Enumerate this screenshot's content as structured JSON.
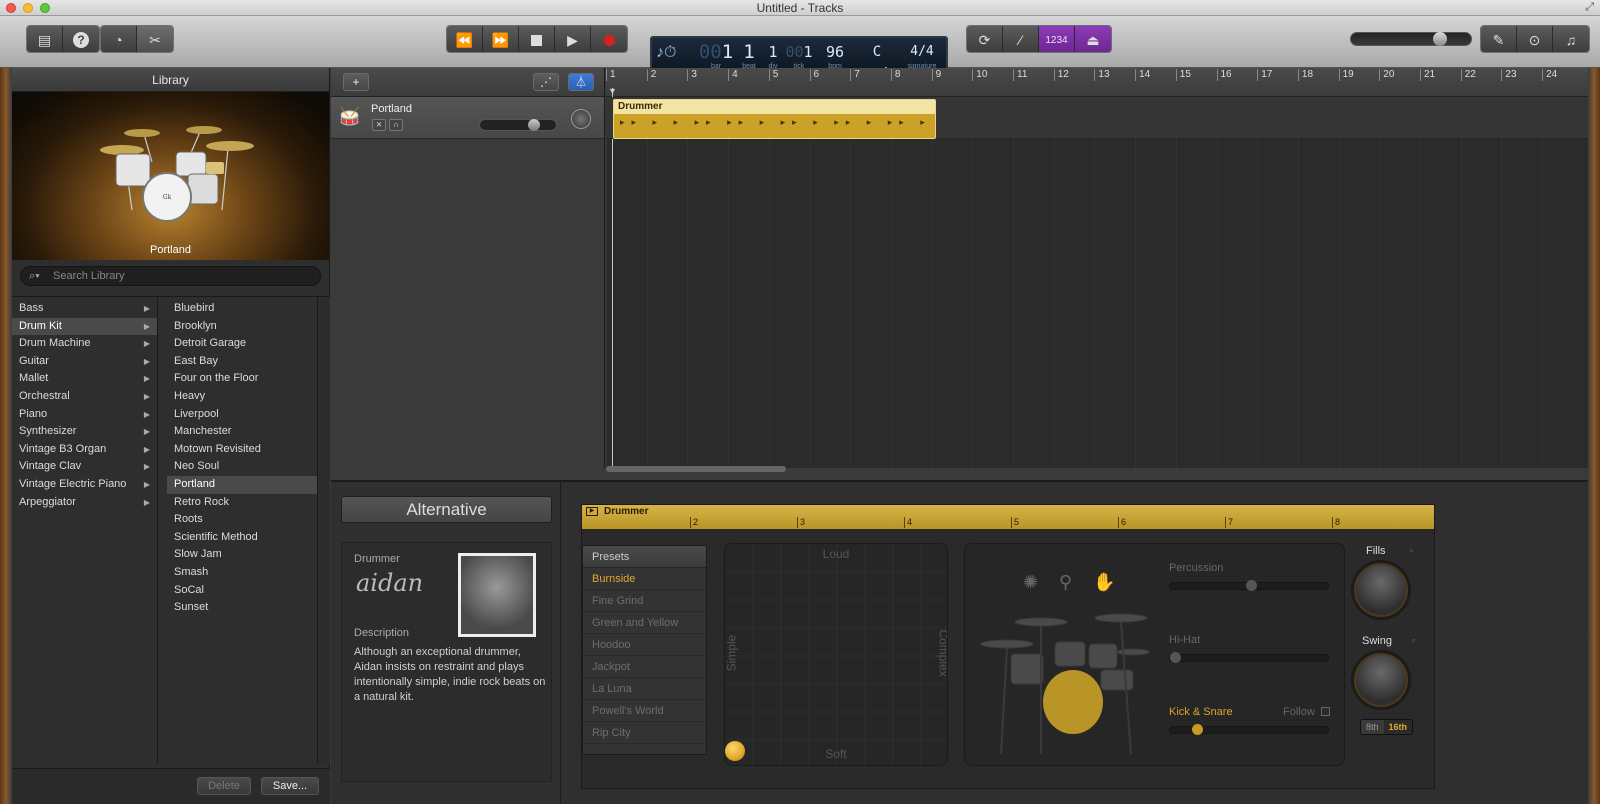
{
  "window": {
    "title": "Untitled - Tracks"
  },
  "toolbar": {
    "lcd": {
      "bar": "1",
      "beat": "1",
      "div": "1",
      "tick": "1",
      "bpm": "96",
      "key": "C maj",
      "signature": "4/4",
      "labels": {
        "bar": "bar",
        "beat": "beat",
        "div": "div",
        "tick": "tick",
        "bpm": "bpm",
        "key": "key",
        "signature": "signature"
      }
    },
    "countin": "1234"
  },
  "library": {
    "header": "Library",
    "patch_caption": "Portland",
    "search_placeholder": "Search Library",
    "categories": [
      "Bass",
      "Drum Kit",
      "Drum Machine",
      "Guitar",
      "Mallet",
      "Orchestral",
      "Piano",
      "Synthesizer",
      "Vintage B3 Organ",
      "Vintage Clav",
      "Vintage Electric Piano",
      "Arpeggiator"
    ],
    "selected_category": "Drum Kit",
    "patches": [
      "Bluebird",
      "Brooklyn",
      "Detroit Garage",
      "East Bay",
      "Four on the Floor",
      "Heavy",
      "Liverpool",
      "Manchester",
      "Motown Revisited",
      "Neo Soul",
      "Portland",
      "Retro Rock",
      "Roots",
      "Scientific Method",
      "Slow Jam",
      "Smash",
      "SoCal",
      "Sunset"
    ],
    "selected_patch": "Portland",
    "delete_label": "Delete",
    "save_label": "Save..."
  },
  "tracks": {
    "track_name": "Portland",
    "region_name": "Drummer",
    "ruler_bars": [
      "1",
      "2",
      "3",
      "4",
      "5",
      "6",
      "7",
      "8",
      "9",
      "10",
      "11",
      "12",
      "13",
      "14",
      "15",
      "16",
      "17",
      "18",
      "19",
      "20",
      "21",
      "22",
      "23",
      "24"
    ]
  },
  "drummer_editor": {
    "alt_button": "Alternative",
    "drummer_label": "Drummer",
    "drummer_signature": "aidan",
    "description_label": "Description",
    "description": "Although an exceptional drummer, Aidan insists on restraint and plays intentionally simple, indie rock beats on a natural kit.",
    "header_title": "Drummer",
    "ruler": [
      "2",
      "3",
      "4",
      "5",
      "6",
      "7",
      "8"
    ],
    "presets_header": "Presets",
    "presets": [
      "Burnside",
      "Fine Grind",
      "Green and Yellow",
      "Hoodoo",
      "Jackpot",
      "La Luna",
      "Powell's World",
      "Rip City"
    ],
    "selected_preset": "Burnside",
    "xy": {
      "top": "Loud",
      "bottom": "Soft",
      "left": "Simple",
      "right": "Complex"
    },
    "percussion_label": "Percussion",
    "hihat_label": "Hi-Hat",
    "kick_snare_label": "Kick & Snare",
    "follow_label": "Follow",
    "fills_label": "Fills",
    "swing_label": "Swing",
    "swing_8th": "8th",
    "swing_16th": "16th",
    "accent": "#e0a92a"
  }
}
